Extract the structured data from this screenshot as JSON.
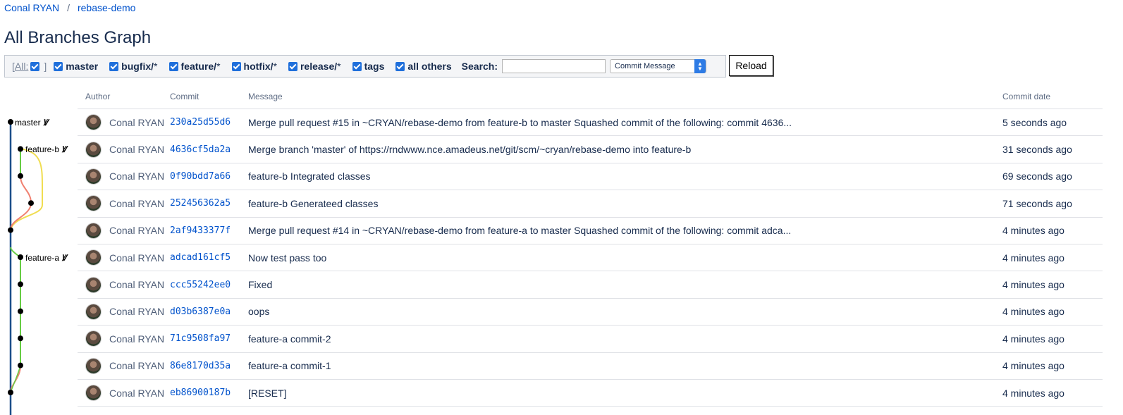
{
  "breadcrumb": {
    "user": "Conal RYAN",
    "separator": "/",
    "repo": "rebase-demo"
  },
  "page_title": "All Branches Graph",
  "filters": {
    "all_open": "[",
    "all_label": "All:",
    "all_close": "]",
    "items": [
      {
        "label": "master",
        "suffix": ""
      },
      {
        "label": "bugfix/",
        "suffix": "*"
      },
      {
        "label": "feature/",
        "suffix": "*"
      },
      {
        "label": "hotfix/",
        "suffix": "*"
      },
      {
        "label": "release/",
        "suffix": "*"
      },
      {
        "label": "tags",
        "suffix": ""
      },
      {
        "label": "all others",
        "suffix": ""
      }
    ],
    "search_label": "Search:",
    "search_value": "",
    "search_mode": "Commit Message",
    "reload_label": "Reload"
  },
  "branch_labels": {
    "master": "master",
    "feature_b": "feature-b",
    "feature_a": "feature-a"
  },
  "graph_colors": {
    "master": "#1b4f8a",
    "feature_b": "#f0dd50",
    "feature_a": "#66cc44",
    "merge": "#f08070"
  },
  "table": {
    "headers": {
      "author": "Author",
      "commit": "Commit",
      "message": "Message",
      "date": "Commit date"
    },
    "rows": [
      {
        "author": "Conal RYAN",
        "commit": "230a25d55d6",
        "message": "Merge pull request #15 in ~CRYAN/rebase-demo from feature-b to master Squashed commit of the following: commit 4636...",
        "date": "5 seconds ago"
      },
      {
        "author": "Conal RYAN",
        "commit": "4636cf5da2a",
        "message": "Merge branch 'master' of https://rndwww.nce.amadeus.net/git/scm/~cryan/rebase-demo into feature-b",
        "date": "31 seconds ago"
      },
      {
        "author": "Conal RYAN",
        "commit": "0f90bdd7a66",
        "message": "feature-b Integrated classes",
        "date": "69 seconds ago"
      },
      {
        "author": "Conal RYAN",
        "commit": "252456362a5",
        "message": "feature-b Generateed classes",
        "date": "71 seconds ago"
      },
      {
        "author": "Conal RYAN",
        "commit": "2af9433377f",
        "message": "Merge pull request #14 in ~CRYAN/rebase-demo from feature-a to master Squashed commit of the following: commit adca...",
        "date": "4 minutes ago"
      },
      {
        "author": "Conal RYAN",
        "commit": "adcad161cf5",
        "message": "Now test pass too",
        "date": "4 minutes ago"
      },
      {
        "author": "Conal RYAN",
        "commit": "ccc55242ee0",
        "message": "Fixed",
        "date": "4 minutes ago"
      },
      {
        "author": "Conal RYAN",
        "commit": "d03b6387e0a",
        "message": "oops",
        "date": "4 minutes ago"
      },
      {
        "author": "Conal RYAN",
        "commit": "71c9508fa97",
        "message": "feature-a commit-2",
        "date": "4 minutes ago"
      },
      {
        "author": "Conal RYAN",
        "commit": "86e8170d35a",
        "message": "feature-a commit-1",
        "date": "4 minutes ago"
      },
      {
        "author": "Conal RYAN",
        "commit": "eb86900187b",
        "message": "[RESET]",
        "date": "4 minutes ago"
      }
    ]
  }
}
